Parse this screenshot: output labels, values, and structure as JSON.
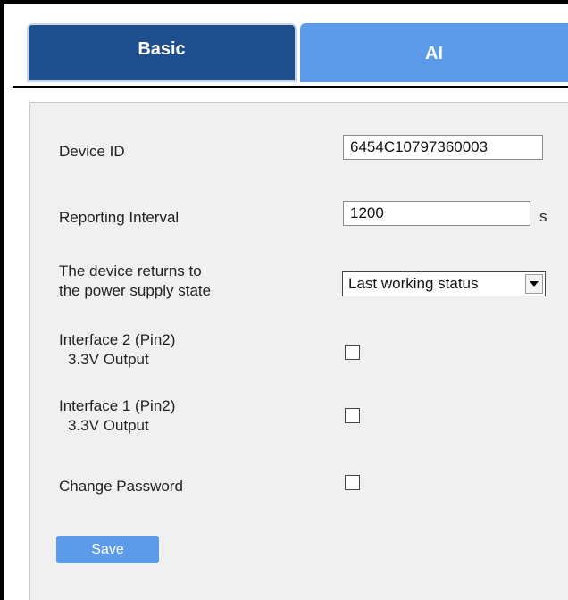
{
  "tabs": [
    {
      "label": "Basic",
      "active": true
    },
    {
      "label": "AI",
      "active": false
    }
  ],
  "colors": {
    "active_tab": "#1f4e8e",
    "inactive_tab": "#5b9bea",
    "panel_bg": "#f0f0f0",
    "save_button": "#5b9bea"
  },
  "settings": {
    "device_id": {
      "label": "Device ID",
      "value": "6454C10797360003"
    },
    "reporting_interval": {
      "label": "Reporting Interval",
      "value": "1200",
      "unit": "s"
    },
    "power_state": {
      "label_line1": "The device returns to",
      "label_line2": "the power supply state",
      "selected": "Last working status"
    },
    "interface2": {
      "label_line1": "Interface 2 (Pin2)",
      "label_line2": "3.3V Output",
      "checked": false
    },
    "interface1": {
      "label_line1": "Interface 1 (Pin2)",
      "label_line2": "3.3V Output",
      "checked": false
    },
    "change_password": {
      "label": "Change Password",
      "checked": false
    }
  },
  "actions": {
    "save_label": "Save"
  }
}
